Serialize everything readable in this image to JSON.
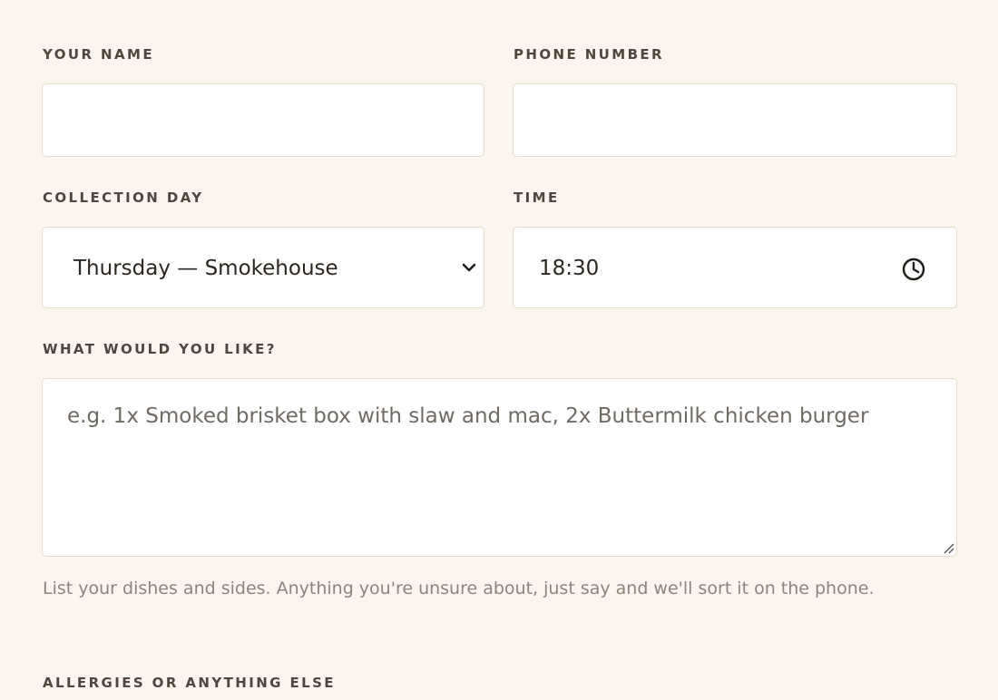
{
  "form": {
    "name": {
      "label": "YOUR NAME",
      "value": ""
    },
    "phone": {
      "label": "PHONE NUMBER",
      "value": ""
    },
    "collection_day": {
      "label": "COLLECTION DAY",
      "selected": "Thursday — Smokehouse"
    },
    "time": {
      "label": "TIME",
      "value": "18:30"
    },
    "order": {
      "label": "WHAT WOULD YOU LIKE?",
      "placeholder": "e.g. 1x Smoked brisket box with slaw and mac, 2x Buttermilk chicken burger",
      "help": "List your dishes and sides. Anything you're unsure about, just say and we'll sort it on the phone."
    },
    "allergies": {
      "label": "ALLERGIES OR ANYTHING ELSE"
    }
  },
  "icons": {
    "select_arrow": "chevron-down-icon",
    "time": "clock-icon",
    "textarea_resize": "resize-grip-icon"
  },
  "colors": {
    "background": "#faf5ef",
    "field_border": "#e8dccb",
    "field_background": "#ffffff",
    "label_text": "#4f473d",
    "help_text": "#8d857b",
    "placeholder_text": "#6f6a64"
  }
}
